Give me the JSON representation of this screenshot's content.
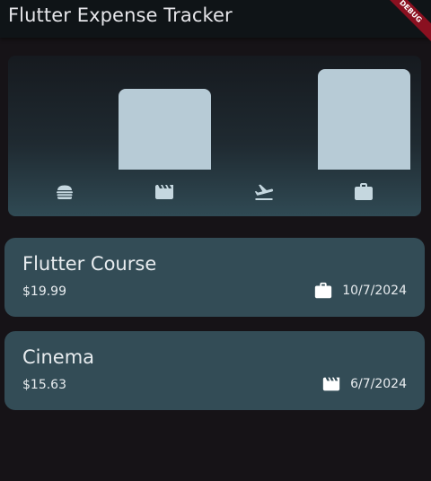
{
  "appbar": {
    "title": "Flutter Expense Tracker",
    "debug_banner": "DEBUG"
  },
  "chart": {
    "bars": [
      {
        "category": "food",
        "icon": "burger-icon",
        "level": 0
      },
      {
        "category": "leisure",
        "icon": "movie-icon",
        "level": 0.8
      },
      {
        "category": "travel",
        "icon": "flight-takeoff-icon",
        "level": 0
      },
      {
        "category": "work",
        "icon": "briefcase-icon",
        "level": 1
      }
    ],
    "bar_color": "#b7cbd6"
  },
  "expenses": [
    {
      "title": "Flutter Course",
      "amount": "$19.99",
      "date": "10/7/2024",
      "icon": "briefcase-icon"
    },
    {
      "title": "Cinema",
      "amount": "$15.63",
      "date": "6/7/2024",
      "icon": "movie-icon"
    }
  ],
  "colors": {
    "background": "#161317",
    "appbar": "#0f1417",
    "card": "#334c56",
    "text": "#e8ecef",
    "debug_ribbon": "#8a1020"
  }
}
